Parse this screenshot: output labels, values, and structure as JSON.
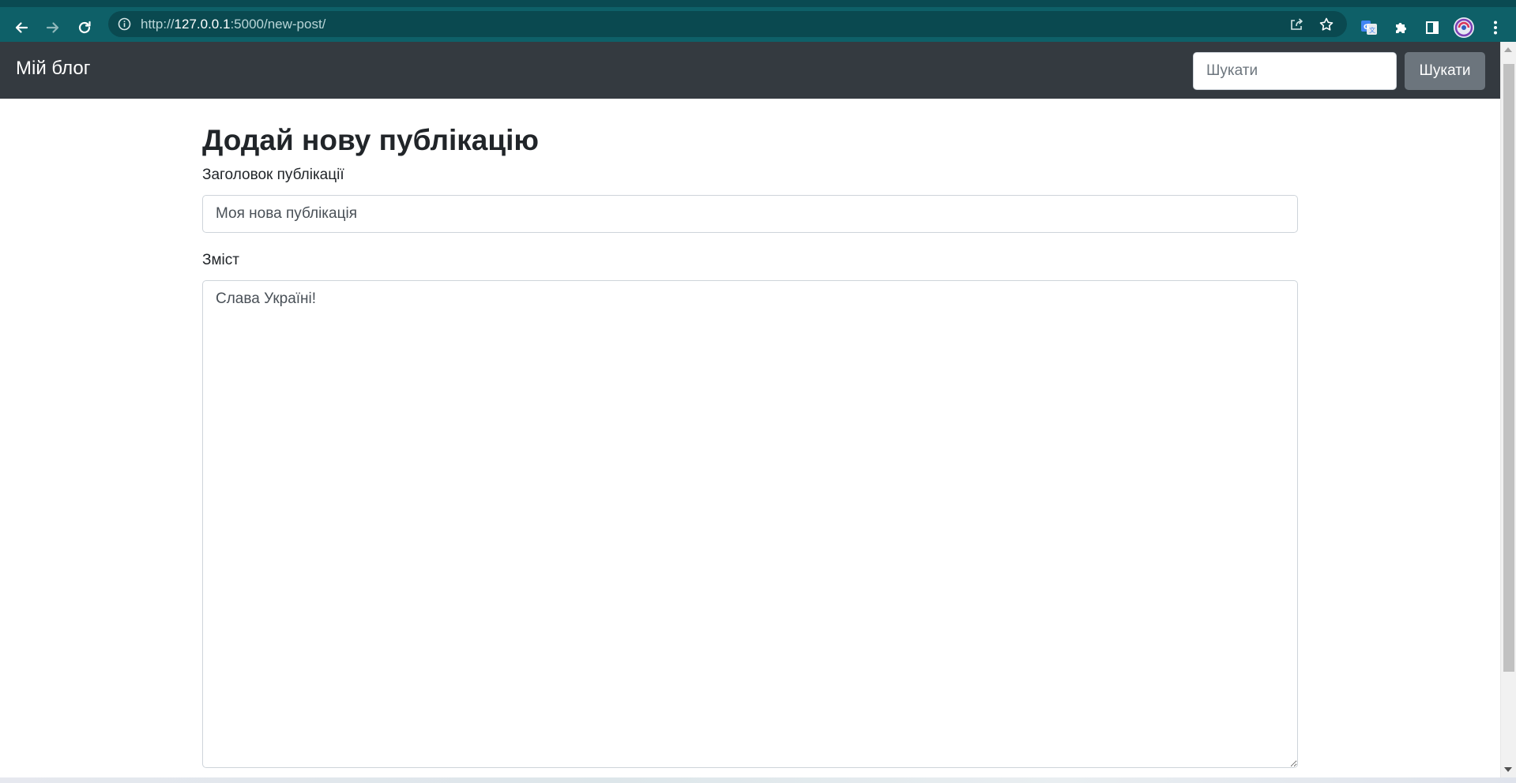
{
  "browser": {
    "url_prefix": "http://",
    "url_host": "127.0.0.1",
    "url_path": ":5000/new-post/",
    "icons": {
      "back": "arrow-left-icon",
      "forward": "arrow-right-icon",
      "reload": "reload-icon",
      "site_info": "info-icon",
      "share": "share-icon",
      "bookmark": "star-icon",
      "translate": "google-translate-icon",
      "extensions": "puzzle-icon",
      "side_panel": "side-panel-icon",
      "profile": "profile-avatar-icon",
      "menu": "kebab-menu-icon"
    },
    "colors": {
      "toolbar": "#0e6068",
      "omnibox": "#0a4950"
    }
  },
  "navbar": {
    "brand": "Мій блог",
    "search_placeholder": "Шукати",
    "search_button": "Шукати",
    "background": "#343a40"
  },
  "form": {
    "heading": "Додай нову публікацію",
    "title_label": "Заголовок публікації",
    "title_value": "Моя нова публікація",
    "body_label": "Зміст",
    "body_value": "Слава Україні!"
  }
}
